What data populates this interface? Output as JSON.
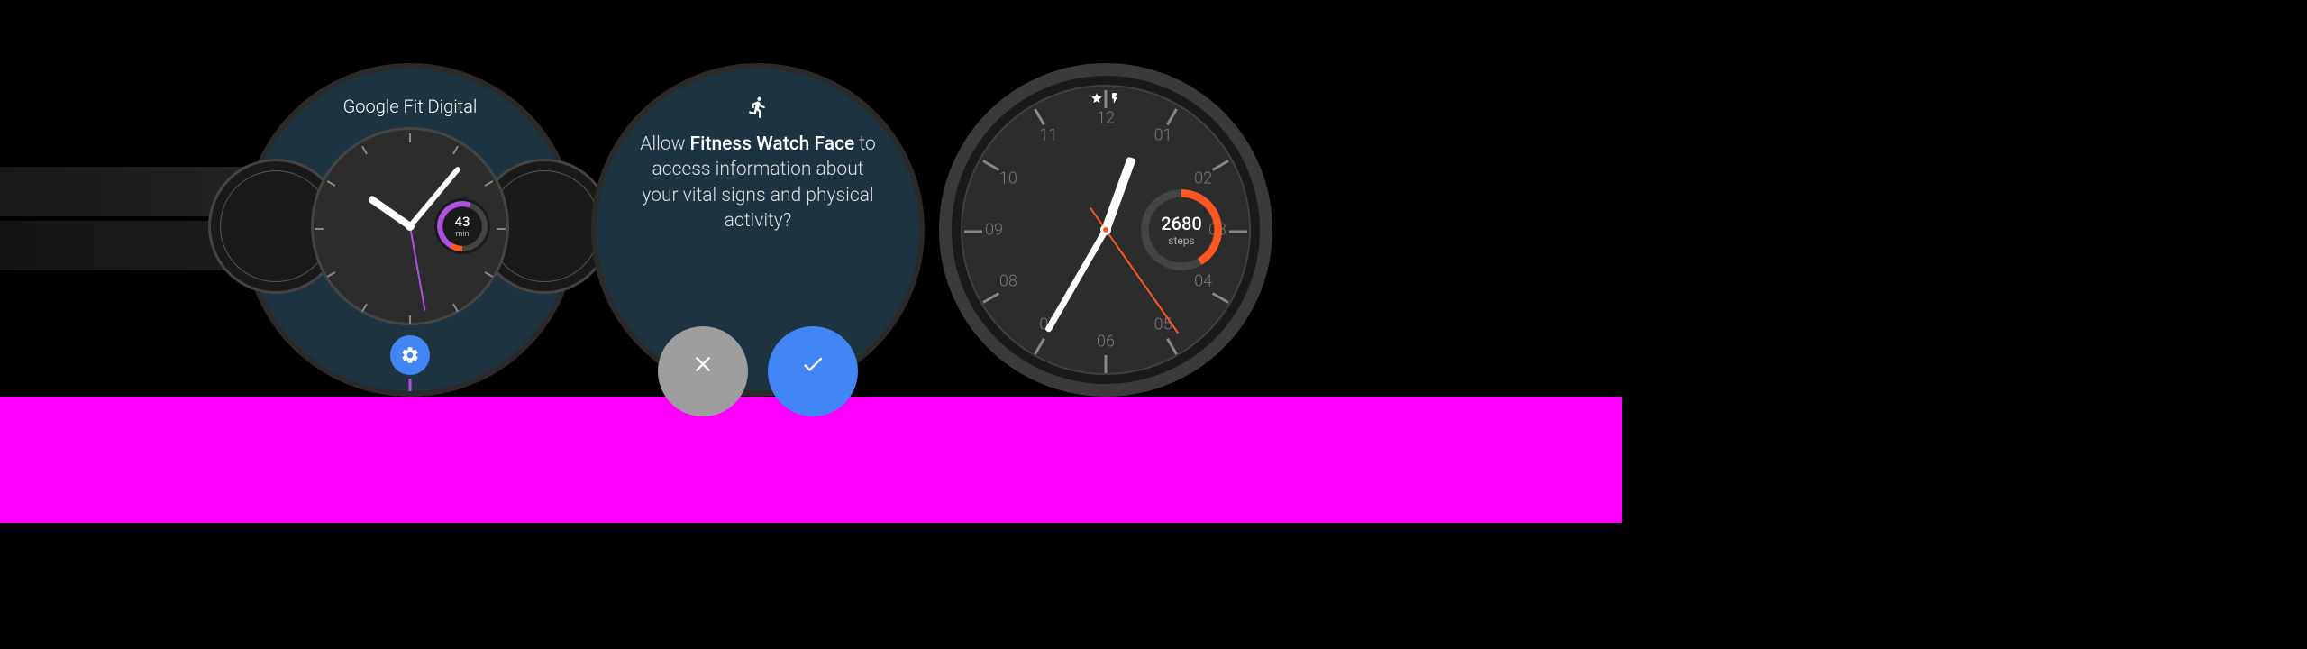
{
  "watch1": {
    "title": "Google Fit Digital",
    "complication": {
      "value": "43",
      "unit": "min"
    }
  },
  "watch2": {
    "prompt_prefix": "Allow ",
    "app_name": "Fitness Watch Face",
    "prompt_suffix": " to access information about your vital signs and physical activity?"
  },
  "watch3": {
    "numerals": {
      "n12": "12",
      "n01": "01",
      "n02": "02",
      "n03": "03",
      "n04": "04",
      "n05": "05",
      "n06": "06",
      "n07": "07",
      "n08": "08",
      "n09": "09",
      "n10": "10",
      "n11": "11"
    },
    "complication": {
      "value": "2680",
      "unit": "steps"
    }
  }
}
